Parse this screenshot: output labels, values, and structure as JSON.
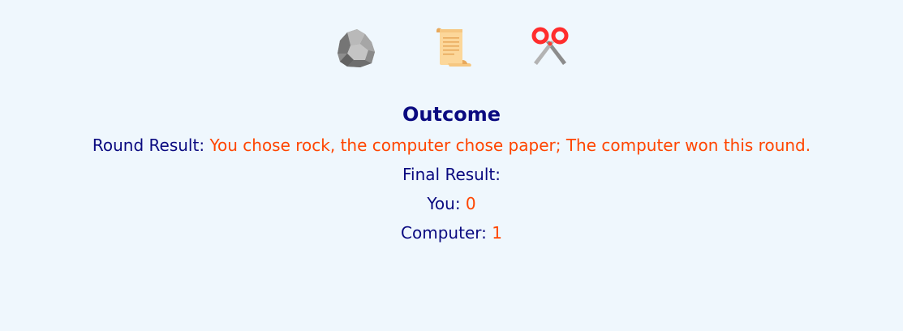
{
  "choices": [
    {
      "id": "rock",
      "icon": "rock-icon"
    },
    {
      "id": "paper",
      "icon": "paper-scroll-icon"
    },
    {
      "id": "scissors",
      "icon": "scissors-icon"
    }
  ],
  "outcome": {
    "title": "Outcome",
    "round_result_label": "Round Result:",
    "round_result_text": "You chose rock, the computer chose paper; The computer won this round.",
    "final_result_label": "Final Result:",
    "you_label": "You:",
    "you_score": "0",
    "computer_label": "Computer:",
    "computer_score": "1"
  },
  "colors": {
    "background": "#eff7fd",
    "text": "#0a0a80",
    "accent": "#ff4500"
  }
}
